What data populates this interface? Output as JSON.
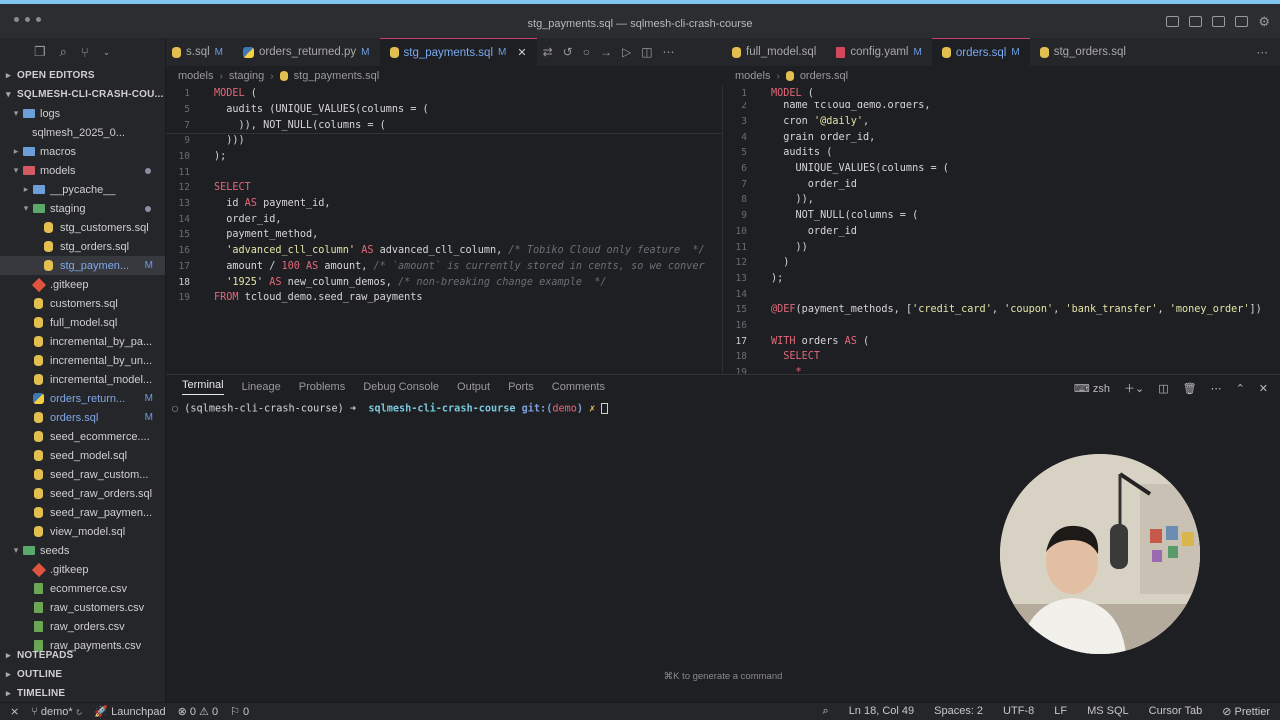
{
  "window": {
    "title": "stg_payments.sql — sqlmesh-cli-crash-course"
  },
  "sidebar": {
    "open_editors": "OPEN EDITORS",
    "project": "SQLMESH-CLI-CRASH-COU...",
    "items": [
      {
        "label": "logs",
        "icon": "folder-icon",
        "chevron": "▾",
        "indent": 1
      },
      {
        "label": "sqlmesh_2025_0...",
        "icon": "none",
        "chevron": "",
        "indent": 2
      },
      {
        "label": "macros",
        "icon": "folder-icon",
        "chevron": "▸",
        "indent": 1
      },
      {
        "label": "models",
        "icon": "folder-red-icon",
        "chevron": "▾",
        "indent": 1,
        "dot": true
      },
      {
        "label": "__pycache__",
        "icon": "folder-icon",
        "chevron": "▸",
        "indent": 2
      },
      {
        "label": "staging",
        "icon": "folder-green-icon",
        "chevron": "▾",
        "indent": 2,
        "dot": true
      },
      {
        "label": "stg_customers.sql",
        "icon": "database-icon",
        "indent": 3
      },
      {
        "label": "stg_orders.sql",
        "icon": "database-icon",
        "indent": 3
      },
      {
        "label": "stg_paymen...",
        "icon": "database-icon",
        "indent": 3,
        "badge": "M",
        "selected": true
      },
      {
        "label": ".gitkeep",
        "icon": "git-icon",
        "indent": 2
      },
      {
        "label": "customers.sql",
        "icon": "database-icon",
        "indent": 2
      },
      {
        "label": "full_model.sql",
        "icon": "database-icon",
        "indent": 2
      },
      {
        "label": "incremental_by_pa...",
        "icon": "database-icon",
        "indent": 2
      },
      {
        "label": "incremental_by_un...",
        "icon": "database-icon",
        "indent": 2
      },
      {
        "label": "incremental_model...",
        "icon": "database-icon",
        "indent": 2
      },
      {
        "label": "orders_return...",
        "icon": "python-icon",
        "indent": 2,
        "badge": "M"
      },
      {
        "label": "orders.sql",
        "icon": "database-icon",
        "indent": 2,
        "badge": "M"
      },
      {
        "label": "seed_ecommerce....",
        "icon": "database-icon",
        "indent": 2
      },
      {
        "label": "seed_model.sql",
        "icon": "database-icon",
        "indent": 2
      },
      {
        "label": "seed_raw_custom...",
        "icon": "database-icon",
        "indent": 2
      },
      {
        "label": "seed_raw_orders.sql",
        "icon": "database-icon",
        "indent": 2
      },
      {
        "label": "seed_raw_paymen...",
        "icon": "database-icon",
        "indent": 2
      },
      {
        "label": "view_model.sql",
        "icon": "database-icon",
        "indent": 2
      },
      {
        "label": "seeds",
        "icon": "folder-green-icon",
        "chevron": "▾",
        "indent": 1
      },
      {
        "label": ".gitkeep",
        "icon": "git-icon",
        "indent": 2
      },
      {
        "label": "ecommerce.csv",
        "icon": "csv-icon",
        "indent": 2
      },
      {
        "label": "raw_customers.csv",
        "icon": "csv-icon",
        "indent": 2
      },
      {
        "label": "raw_orders.csv",
        "icon": "csv-icon",
        "indent": 2
      },
      {
        "label": "raw_payments.csv",
        "icon": "csv-icon",
        "indent": 2
      }
    ],
    "notepads": "NOTEPADS",
    "outline": "OUTLINE",
    "timeline": "TIMELINE"
  },
  "left_tabs": [
    {
      "label": "s.sql",
      "badge": "M",
      "icon": "database-icon"
    },
    {
      "label": "orders_returned.py",
      "badge": "M",
      "icon": "python-icon"
    },
    {
      "label": "stg_payments.sql",
      "badge": "M",
      "icon": "database-icon",
      "active": true,
      "close": "✕"
    }
  ],
  "right_tabs": [
    {
      "label": "full_model.sql",
      "badge": "",
      "icon": "database-icon"
    },
    {
      "label": "config.yaml",
      "badge": "M",
      "icon": "yaml-icon"
    },
    {
      "label": "orders.sql",
      "badge": "M",
      "icon": "database-icon",
      "active": true
    },
    {
      "label": "stg_orders.sql",
      "badge": "",
      "icon": "database-icon"
    }
  ],
  "left_breadcrumb": [
    "models",
    "staging",
    "stg_payments.sql"
  ],
  "right_breadcrumb": [
    "models",
    "orders.sql"
  ],
  "left_editor": {
    "sticky": [
      {
        "n": "1",
        "code": [
          [
            "kw",
            "MODEL"
          ],
          [
            "fn",
            " ("
          ]
        ]
      },
      {
        "n": "5",
        "code": [
          [
            "fn",
            "  audits ("
          ],
          [
            "fn",
            "UNIQUE_VALUES"
          ],
          [
            "fn",
            "(columns = ("
          ]
        ]
      },
      {
        "n": "7",
        "code": [
          [
            "fn",
            "    )), "
          ],
          [
            "fn",
            "NOT_NULL"
          ],
          [
            "fn",
            "(columns = ("
          ]
        ]
      }
    ],
    "lines": [
      {
        "n": "9",
        "code": [
          [
            "fn",
            "  )))"
          ]
        ]
      },
      {
        "n": "10",
        "code": [
          [
            "fn",
            ");"
          ]
        ]
      },
      {
        "n": "11",
        "code": []
      },
      {
        "n": "12",
        "code": [
          [
            "kw",
            "SELECT"
          ]
        ]
      },
      {
        "n": "13",
        "code": [
          [
            "fn",
            "  id "
          ],
          [
            "kw",
            "AS"
          ],
          [
            "fn",
            " payment_id,"
          ]
        ]
      },
      {
        "n": "14",
        "code": [
          [
            "fn",
            "  order_id,"
          ]
        ]
      },
      {
        "n": "15",
        "code": [
          [
            "fn",
            "  payment_method,"
          ]
        ]
      },
      {
        "n": "16",
        "code": [
          [
            "str",
            "  'advanced_cll_column'"
          ],
          [
            "kw",
            " AS"
          ],
          [
            "fn",
            " advanced_cll_column, "
          ],
          [
            "cm",
            "/* Tobiko Cloud only feature  */"
          ]
        ]
      },
      {
        "n": "17",
        "code": [
          [
            "fn",
            "  amount / "
          ],
          [
            "num",
            "100"
          ],
          [
            "kw",
            " AS"
          ],
          [
            "fn",
            " amount, "
          ],
          [
            "cm",
            "/* `amount` is currently stored in cents, so we conver"
          ]
        ]
      },
      {
        "n": "18",
        "code": [
          [
            "str",
            "  '1925'"
          ],
          [
            "kw",
            " AS"
          ],
          [
            "fn",
            " new_column_demos, "
          ],
          [
            "cm",
            "/* non-breaking change example  */"
          ]
        ],
        "current": true
      },
      {
        "n": "19",
        "code": [
          [
            "kw",
            "FROM"
          ],
          [
            "fn",
            " tcloud_demo.seed_raw_payments"
          ]
        ]
      }
    ]
  },
  "right_editor": {
    "sticky": [
      {
        "n": "1",
        "code": [
          [
            "kw",
            "MODEL"
          ],
          [
            "fn",
            " ("
          ]
        ]
      }
    ],
    "lines": [
      {
        "n": "2",
        "code": [
          [
            "fn",
            "  name tcloud_demo.orders,"
          ]
        ]
      },
      {
        "n": "3",
        "code": [
          [
            "fn",
            "  cron "
          ],
          [
            "str",
            "'@daily'"
          ],
          [
            "fn",
            ","
          ]
        ]
      },
      {
        "n": "4",
        "code": [
          [
            "fn",
            "  grain order_id,"
          ]
        ]
      },
      {
        "n": "5",
        "code": [
          [
            "fn",
            "  audits ("
          ]
        ]
      },
      {
        "n": "6",
        "code": [
          [
            "fn",
            "    UNIQUE_VALUES(columns = ("
          ]
        ]
      },
      {
        "n": "7",
        "code": [
          [
            "fn",
            "      order_id"
          ]
        ]
      },
      {
        "n": "8",
        "code": [
          [
            "fn",
            "    )),"
          ]
        ]
      },
      {
        "n": "9",
        "code": [
          [
            "fn",
            "    NOT_NULL(columns = ("
          ]
        ]
      },
      {
        "n": "10",
        "code": [
          [
            "fn",
            "      order_id"
          ]
        ]
      },
      {
        "n": "11",
        "code": [
          [
            "fn",
            "    ))"
          ]
        ]
      },
      {
        "n": "12",
        "code": [
          [
            "fn",
            "  )"
          ]
        ]
      },
      {
        "n": "13",
        "code": [
          [
            "fn",
            ");"
          ]
        ]
      },
      {
        "n": "14",
        "code": []
      },
      {
        "n": "15",
        "code": [
          [
            "kw",
            "@DEF"
          ],
          [
            "fn",
            "(payment_methods, ["
          ],
          [
            "str",
            "'credit_card'"
          ],
          [
            "fn",
            ", "
          ],
          [
            "str",
            "'coupon'"
          ],
          [
            "fn",
            ", "
          ],
          [
            "str",
            "'bank_transfer'"
          ],
          [
            "fn",
            ", "
          ],
          [
            "str",
            "'money_order'"
          ],
          [
            "fn",
            "])"
          ]
        ]
      },
      {
        "n": "16",
        "code": []
      },
      {
        "n": "17",
        "code": [
          [
            "kw",
            "WITH"
          ],
          [
            "fn",
            " orders "
          ],
          [
            "kw",
            "AS"
          ],
          [
            "fn",
            " ("
          ]
        ],
        "current": true
      },
      {
        "n": "18",
        "code": [
          [
            "kw",
            "  SELECT"
          ]
        ]
      },
      {
        "n": "19",
        "code": [
          [
            "kw",
            "    *"
          ]
        ]
      }
    ]
  },
  "panel": {
    "tabs": [
      "Terminal",
      "Lineage",
      "Problems",
      "Debug Console",
      "Output",
      "Ports",
      "Comments"
    ],
    "shell": "zsh",
    "prompt_env": "(sqlmesh-cli-crash-course)",
    "prompt_arrow": "➜",
    "prompt_dir": "sqlmesh-cli-crash-course",
    "prompt_git": "git:(",
    "prompt_branch": "demo",
    "prompt_git_close": ")",
    "prompt_dirty": "✗",
    "hint": "⌘K to generate a command"
  },
  "statusbar": {
    "branch": "demo*",
    "launchpad": "Launchpad",
    "errors": "0",
    "warnings": "0",
    "ports": "0",
    "position": "Ln 18, Col 49",
    "spaces": "Spaces: 2",
    "encoding": "UTF-8",
    "eol": "LF",
    "language": "MS SQL",
    "cursor_tab": "Cursor Tab",
    "prettier": "Prettier"
  }
}
